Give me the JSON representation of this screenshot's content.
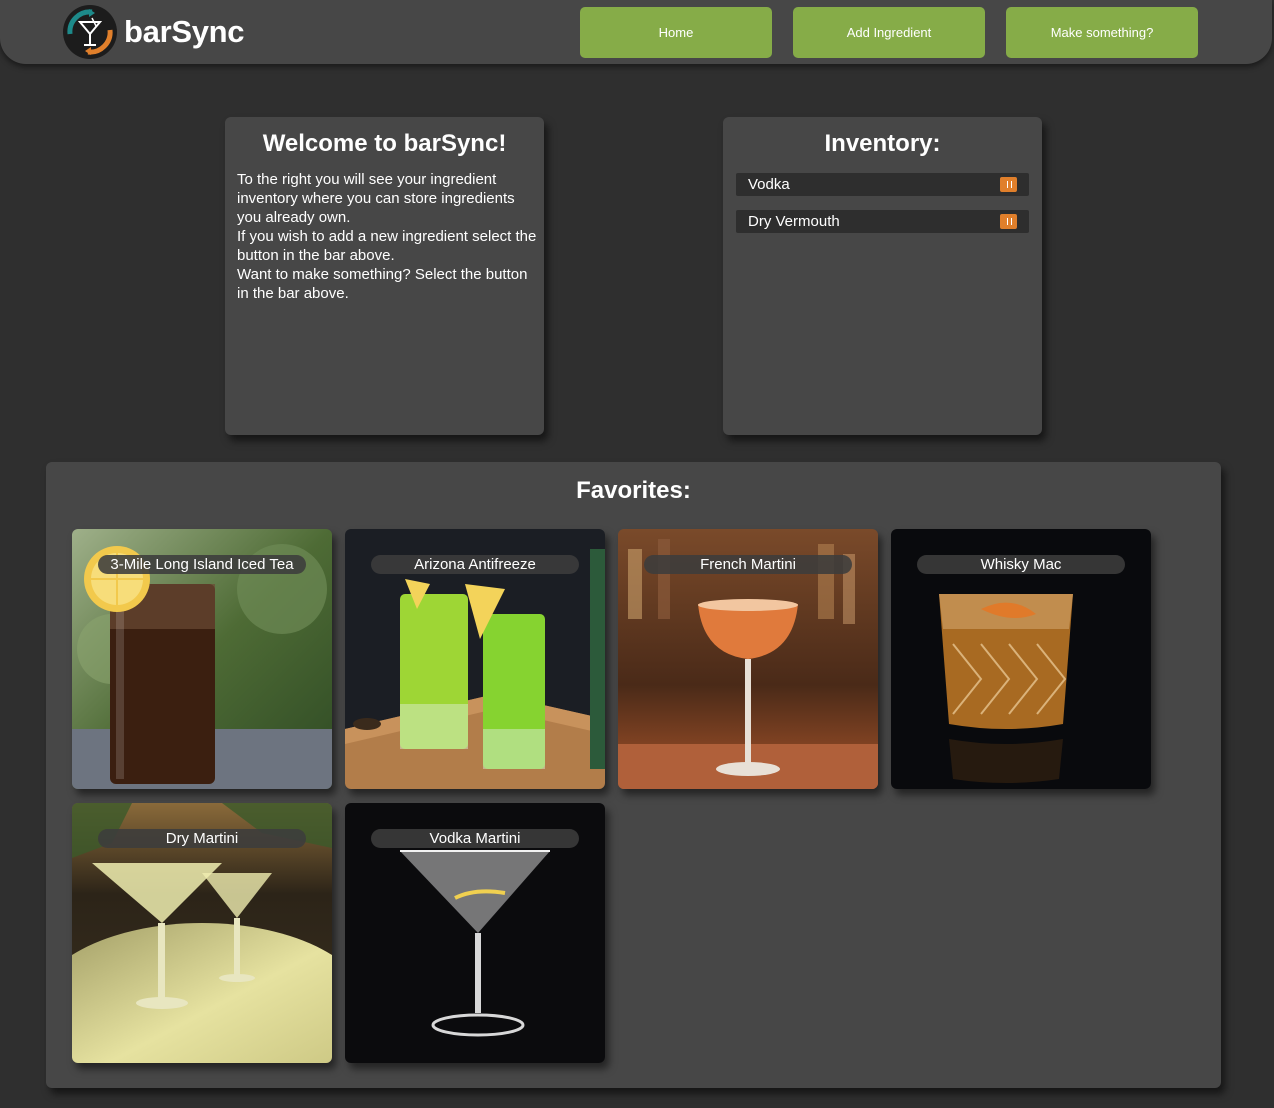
{
  "app": {
    "brand": "barSync"
  },
  "nav": {
    "home_label": "Home",
    "add_ingredient_label": "Add Ingredient",
    "make_something_label": "Make something?"
  },
  "welcome": {
    "title": "Welcome to barSync!",
    "lines": [
      "To the right you will see your ingredient inventory where you can store ingredients you already own.",
      "If you wish to add a new ingredient select the button in the bar above.",
      "Want to make something? Select the button in the bar above."
    ]
  },
  "inventory": {
    "title": "Inventory:",
    "items": [
      {
        "label": "Vodka"
      },
      {
        "label": "Dry Vermouth"
      }
    ]
  },
  "favorites": {
    "title": "Favorites:",
    "items": [
      {
        "name": "3-Mile Long Island Iced Tea"
      },
      {
        "name": "Arizona Antifreeze"
      },
      {
        "name": "French Martini"
      },
      {
        "name": "Whisky Mac"
      },
      {
        "name": "Dry Martini"
      },
      {
        "name": "Vodka Martini"
      }
    ]
  },
  "colors": {
    "accent": "#86ac48",
    "navbar": "#474747",
    "background": "#2f2f2f",
    "panel": "#474747",
    "trash": "#e07f2b"
  },
  "icons": {
    "logo": "martini-glass-sync-icon",
    "delete": "trash-icon"
  }
}
